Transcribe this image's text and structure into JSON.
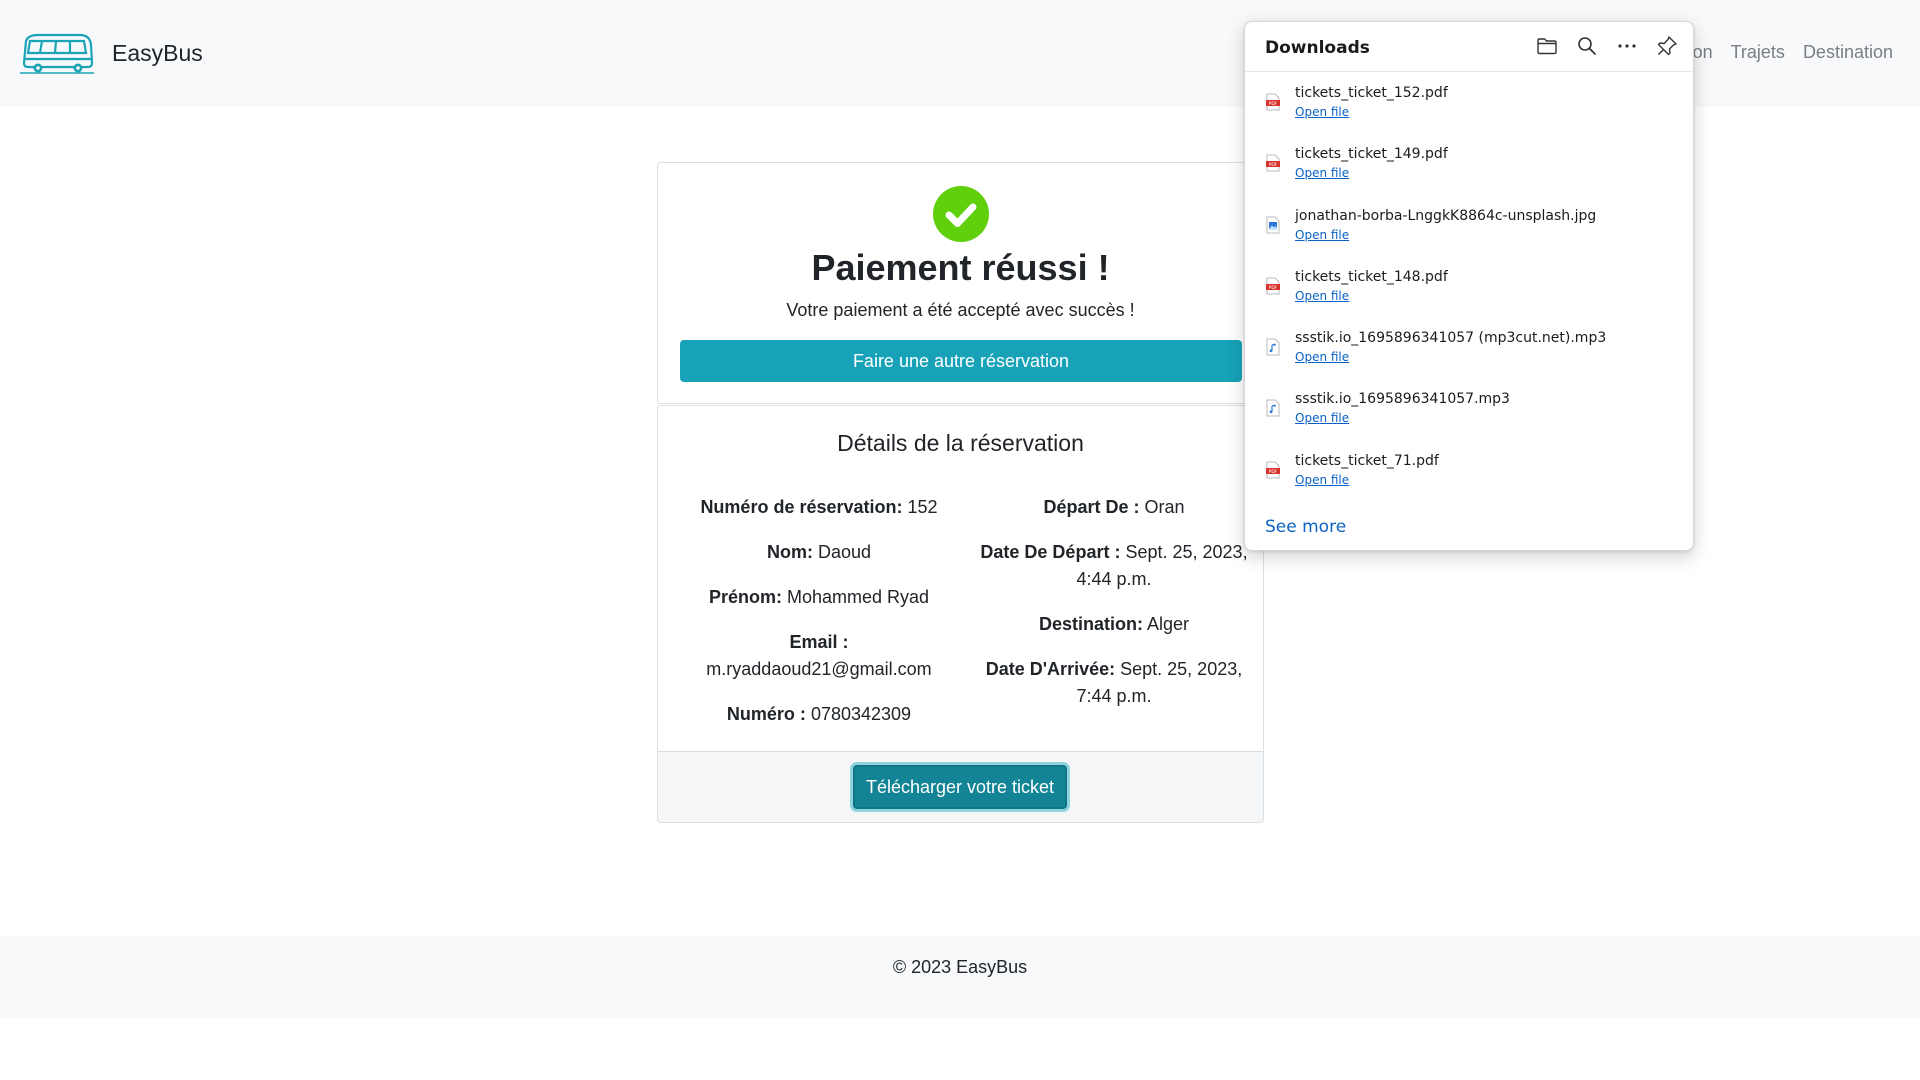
{
  "navbar": {
    "brand": "EasyBus",
    "links": [
      "on",
      "Trajets",
      "Destination"
    ]
  },
  "success": {
    "title": "Paiement réussi !",
    "message": "Votre paiement a été accepté avec succès !",
    "button": "Faire une autre réservation"
  },
  "details": {
    "title": "Détails de la réservation",
    "left": [
      {
        "label": "Numéro de réservation:",
        "value": "152"
      },
      {
        "label": "Nom:",
        "value": "Daoud"
      },
      {
        "label": "Prénom:",
        "value": "Mohammed Ryad"
      },
      {
        "label": "Email :",
        "value": "m.ryaddaoud21@gmail.com"
      },
      {
        "label": "Numéro :",
        "value": "0780342309"
      }
    ],
    "right": [
      {
        "label": "Départ De :",
        "value": "Oran"
      },
      {
        "label": "Date De Départ :",
        "value": "Sept. 25, 2023, 4:44 p.m."
      },
      {
        "label": "Destination:",
        "value": "Alger"
      },
      {
        "label": "Date D'Arrivée:",
        "value": "Sept. 25, 2023, 7:44 p.m."
      }
    ],
    "download_button": "Télécharger votre ticket"
  },
  "footer": {
    "text": "© 2023 EasyBus"
  },
  "downloads": {
    "title": "Downloads",
    "items": [
      {
        "name": "tickets_ticket_152.pdf",
        "action": "Open file",
        "icon": "pdf-file-icon"
      },
      {
        "name": "tickets_ticket_149.pdf",
        "action": "Open file",
        "icon": "pdf-file-icon"
      },
      {
        "name": "jonathan-borba-LnggkK8864c-unsplash.jpg",
        "action": "Open file",
        "icon": "image-file-icon"
      },
      {
        "name": "tickets_ticket_148.pdf",
        "action": "Open file",
        "icon": "pdf-file-icon"
      },
      {
        "name": "ssstik.io_1695896341057 (mp3cut.net).mp3",
        "action": "Open file",
        "icon": "audio-file-icon"
      },
      {
        "name": "ssstik.io_1695896341057.mp3",
        "action": "Open file",
        "icon": "audio-file-icon"
      },
      {
        "name": "tickets_ticket_71.pdf",
        "action": "Open file",
        "icon": "pdf-file-icon"
      }
    ],
    "see_more": "See more"
  },
  "colors": {
    "accent": "#17a2b8",
    "accent_dark": "#138496",
    "success": "#5fd00b",
    "link": "#0b62c4",
    "navbar_bg": "#f8f9fa"
  }
}
